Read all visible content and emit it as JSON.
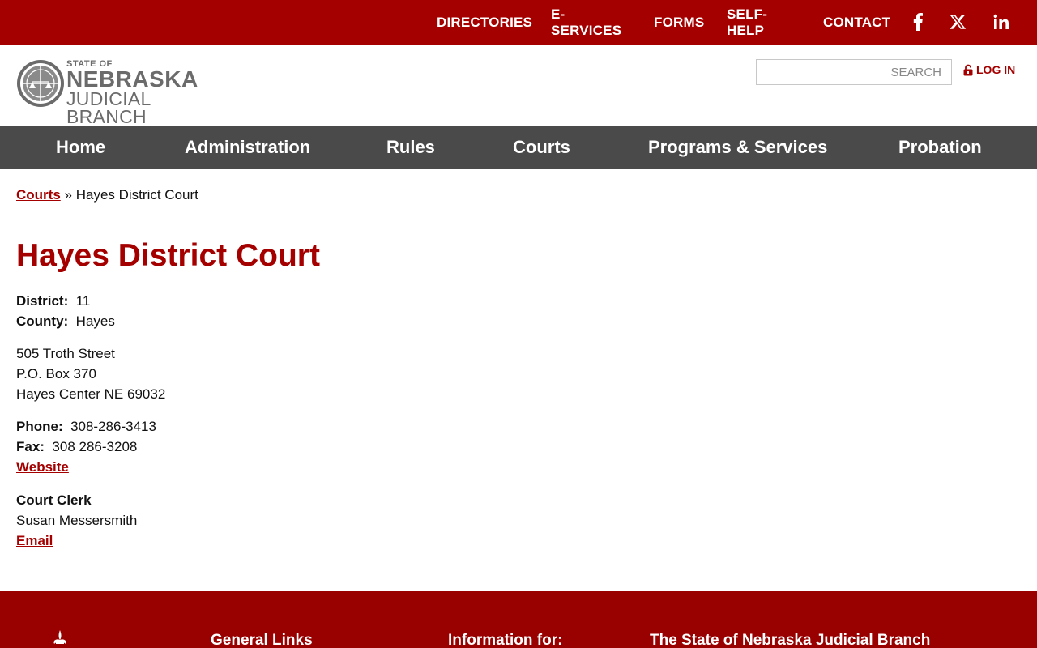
{
  "topnav": {
    "items": [
      "DIRECTORIES",
      "E-SERVICES",
      "FORMS",
      "SELF-HELP",
      "CONTACT"
    ],
    "social": [
      "facebook-icon",
      "x-icon",
      "linkedin-icon"
    ]
  },
  "header": {
    "logo_state": "STATE OF",
    "logo_name": "NEBRASKA",
    "logo_branch": "JUDICIAL BRANCH",
    "search_placeholder": "SEARCH",
    "login_label": "LOG IN"
  },
  "mainnav": {
    "items": [
      "Home",
      "Administration",
      "Rules",
      "Courts",
      "Programs & Services",
      "Probation"
    ]
  },
  "breadcrumb": {
    "link": "Courts",
    "separator": "»",
    "current": "Hayes District Court"
  },
  "page": {
    "title": "Hayes District Court",
    "district_label": "District:",
    "district_value": "11",
    "county_label": "County:",
    "county_value": "Hayes",
    "address_line1": "505 Troth Street",
    "address_line2": "P.O. Box 370",
    "address_line3": "Hayes Center NE 69032",
    "phone_label": "Phone:",
    "phone_value": "308-286-3413",
    "fax_label": "Fax:",
    "fax_value": "308 286-3208",
    "website_label": "Website",
    "clerk_title": "Court Clerk",
    "clerk_name": "Susan Messersmith",
    "email_label": "Email"
  },
  "footer": {
    "headings": [
      "General Links",
      "Information for:",
      "The State of Nebraska Judicial Branch"
    ]
  },
  "colors": {
    "brand_red": "#a50000",
    "nav_gray": "#4a4a4a",
    "footer_red": "#990000"
  }
}
